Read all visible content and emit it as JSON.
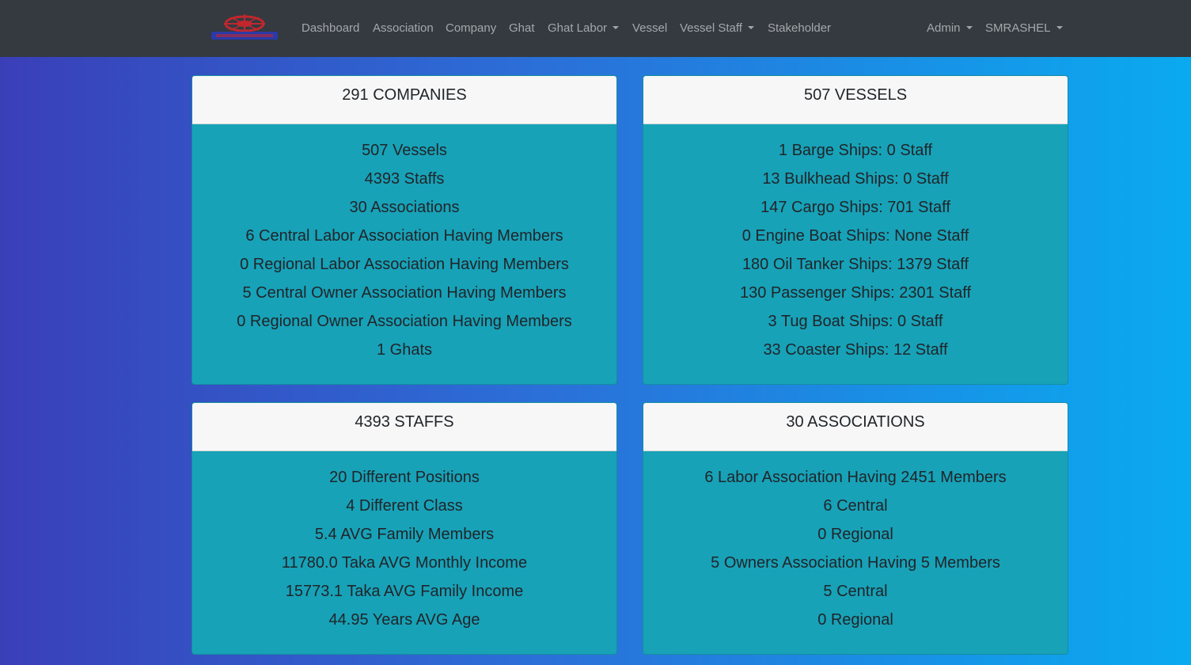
{
  "navbar": {
    "logo_text": "",
    "items": [
      {
        "label": "Dashboard"
      },
      {
        "label": "Association"
      },
      {
        "label": "Company"
      },
      {
        "label": "Ghat"
      },
      {
        "label": "Ghat Labor"
      },
      {
        "label": "Vessel"
      },
      {
        "label": "Vessel Staff"
      },
      {
        "label": "Stakeholder"
      }
    ],
    "right_items": [
      {
        "label": "Admin"
      },
      {
        "label": "SMRASHEL"
      }
    ]
  },
  "cards": {
    "companies": {
      "title": "291 COMPANIES",
      "lines": [
        "507 Vessels",
        "4393 Staffs",
        "30 Associations",
        "6 Central Labor Association Having Members",
        "0 Regional Labor Association Having Members",
        "5 Central Owner Association Having Members",
        "0 Regional Owner Association Having Members",
        "1 Ghats"
      ]
    },
    "vessels": {
      "title": "507 VESSELS",
      "lines": [
        "1 Barge Ships: 0 Staff",
        "13 Bulkhead Ships: 0 Staff",
        "147 Cargo Ships: 701 Staff",
        "0 Engine Boat Ships: None Staff",
        "180 Oil Tanker Ships: 1379 Staff",
        "130 Passenger Ships: 2301 Staff",
        "3 Tug Boat Ships: 0 Staff",
        "33 Coaster Ships: 12 Staff"
      ]
    },
    "staffs": {
      "title": "4393 STAFFS",
      "lines": [
        "20 Different Positions",
        "4 Different Class",
        "5.4 AVG Family Members",
        "11780.0 Taka AVG Monthly Income",
        "15773.1 Taka AVG Family Income",
        "44.95 Years AVG Age"
      ]
    },
    "associations": {
      "title": "30 ASSOCIATIONS",
      "lines": [
        "6 Labor Association Having 2451 Members",
        "6 Central",
        "0 Regional",
        "5 Owners Association Having 5 Members",
        "5 Central",
        "0 Regional"
      ]
    }
  },
  "colors": {
    "navbar_bg": "#343a40",
    "card_body_bg": "#17a2b8",
    "card_header_bg": "#f7f7f7",
    "gradient_start": "#3a3fb8",
    "gradient_end": "#0aaaf0"
  }
}
